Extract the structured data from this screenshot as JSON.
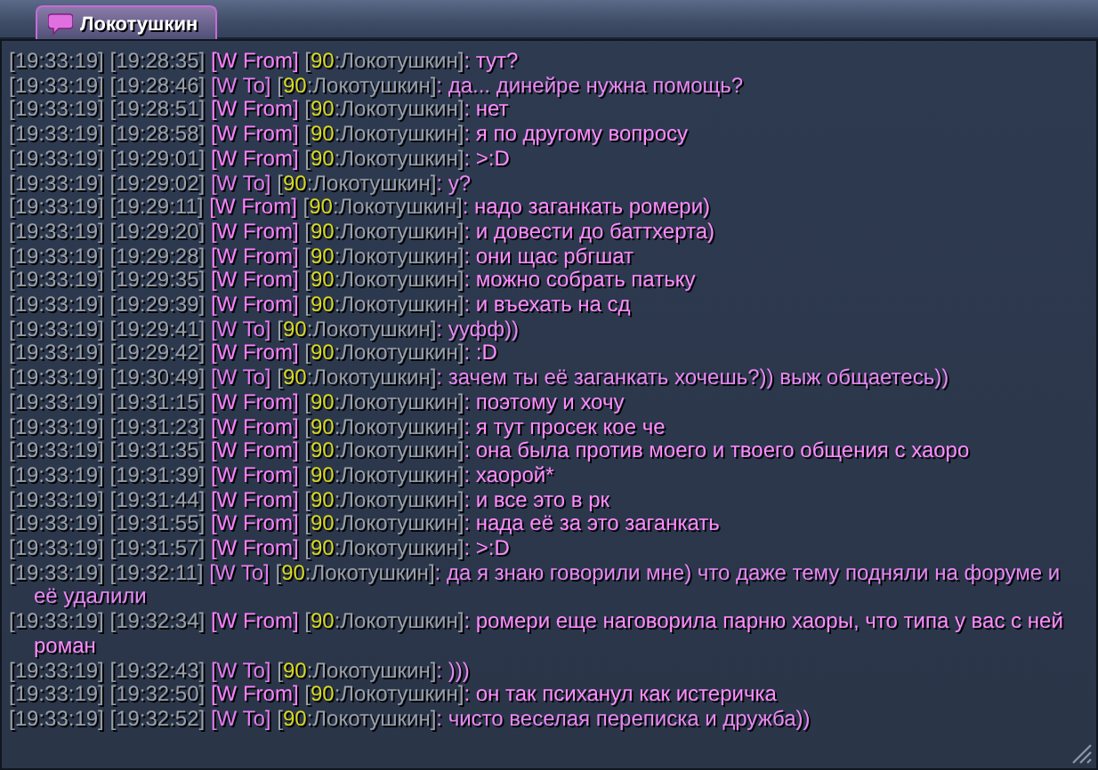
{
  "tab": {
    "label": "Локотушкин",
    "selected": true
  },
  "messages": [
    {
      "kind": "from",
      "local_time": "[19:33:19]",
      "time": "[19:28:35]",
      "channel": "[W From]",
      "sender_open": "[",
      "rank": "90",
      "sender": ":Локотушкин]",
      "text": ": тут?"
    },
    {
      "kind": "to",
      "local_time": "[19:33:19]",
      "time": "[19:28:46]",
      "channel": "[W To]",
      "sender_open": "[",
      "rank": "90",
      "sender": ":Локотушкин]",
      "text": ": да... динейре нужна помощь?"
    },
    {
      "kind": "from",
      "local_time": "[19:33:19]",
      "time": "[19:28:51]",
      "channel": "[W From]",
      "sender_open": "[",
      "rank": "90",
      "sender": ":Локотушкин]",
      "text": ": нет"
    },
    {
      "kind": "from",
      "local_time": "[19:33:19]",
      "time": "[19:28:58]",
      "channel": "[W From]",
      "sender_open": "[",
      "rank": "90",
      "sender": ":Локотушкин]",
      "text": ": я по другому вопросу"
    },
    {
      "kind": "from",
      "local_time": "[19:33:19]",
      "time": "[19:29:01]",
      "channel": "[W From]",
      "sender_open": "[",
      "rank": "90",
      "sender": ":Локотушкин]",
      "text": ": >:D"
    },
    {
      "kind": "to",
      "local_time": "[19:33:19]",
      "time": "[19:29:02]",
      "channel": "[W To]",
      "sender_open": "[",
      "rank": "90",
      "sender": ":Локотушкин]",
      "text": ": у?"
    },
    {
      "kind": "from",
      "local_time": "[19:33:19]",
      "time": "[19:29:11]",
      "channel": "[W From]",
      "sender_open": "[",
      "rank": "90",
      "sender": ":Локотушкин]",
      "text": ": надо заганкать ромери)"
    },
    {
      "kind": "from",
      "local_time": "[19:33:19]",
      "time": "[19:29:20]",
      "channel": "[W From]",
      "sender_open": "[",
      "rank": "90",
      "sender": ":Локотушкин]",
      "text": ": и довести до баттхерта)"
    },
    {
      "kind": "from",
      "local_time": "[19:33:19]",
      "time": "[19:29:28]",
      "channel": "[W From]",
      "sender_open": "[",
      "rank": "90",
      "sender": ":Локотушкин]",
      "text": ": они щас рбгшат"
    },
    {
      "kind": "from",
      "local_time": "[19:33:19]",
      "time": "[19:29:35]",
      "channel": "[W From]",
      "sender_open": "[",
      "rank": "90",
      "sender": ":Локотушкин]",
      "text": ": можно собрать патьку"
    },
    {
      "kind": "from",
      "local_time": "[19:33:19]",
      "time": "[19:29:39]",
      "channel": "[W From]",
      "sender_open": "[",
      "rank": "90",
      "sender": ":Локотушкин]",
      "text": ": и въехать на сд"
    },
    {
      "kind": "to",
      "local_time": "[19:33:19]",
      "time": "[19:29:41]",
      "channel": "[W To]",
      "sender_open": "[",
      "rank": "90",
      "sender": ":Локотушкин]",
      "text": ": ууфф))"
    },
    {
      "kind": "from",
      "local_time": "[19:33:19]",
      "time": "[19:29:42]",
      "channel": "[W From]",
      "sender_open": "[",
      "rank": "90",
      "sender": ":Локотушкин]",
      "text": ": :D"
    },
    {
      "kind": "to",
      "local_time": "[19:33:19]",
      "time": "[19:30:49]",
      "channel": "[W To]",
      "sender_open": "[",
      "rank": "90",
      "sender": ":Локотушкин]",
      "text": ": зачем ты её заганкать хочешь?)) выж общаетесь))"
    },
    {
      "kind": "from",
      "local_time": "[19:33:19]",
      "time": "[19:31:15]",
      "channel": "[W From]",
      "sender_open": "[",
      "rank": "90",
      "sender": ":Локотушкин]",
      "text": ": поэтому и хочу"
    },
    {
      "kind": "from",
      "local_time": "[19:33:19]",
      "time": "[19:31:23]",
      "channel": "[W From]",
      "sender_open": "[",
      "rank": "90",
      "sender": ":Локотушкин]",
      "text": ": я тут просек кое че"
    },
    {
      "kind": "from",
      "local_time": "[19:33:19]",
      "time": "[19:31:35]",
      "channel": "[W From]",
      "sender_open": "[",
      "rank": "90",
      "sender": ":Локотушкин]",
      "text": ": она была против моего и твоего общения с хаоро"
    },
    {
      "kind": "from",
      "local_time": "[19:33:19]",
      "time": "[19:31:39]",
      "channel": "[W From]",
      "sender_open": "[",
      "rank": "90",
      "sender": ":Локотушкин]",
      "text": ": хаорой*"
    },
    {
      "kind": "from",
      "local_time": "[19:33:19]",
      "time": "[19:31:44]",
      "channel": "[W From]",
      "sender_open": "[",
      "rank": "90",
      "sender": ":Локотушкин]",
      "text": ": и все это в рк"
    },
    {
      "kind": "from",
      "local_time": "[19:33:19]",
      "time": "[19:31:55]",
      "channel": "[W From]",
      "sender_open": "[",
      "rank": "90",
      "sender": ":Локотушкин]",
      "text": ": нада её за это заганкать"
    },
    {
      "kind": "from",
      "local_time": "[19:33:19]",
      "time": "[19:31:57]",
      "channel": "[W From]",
      "sender_open": "[",
      "rank": "90",
      "sender": ":Локотушкин]",
      "text": ": >:D"
    },
    {
      "kind": "to",
      "local_time": "[19:33:19]",
      "time": "[19:32:11]",
      "channel": "[W To]",
      "sender_open": "[",
      "rank": "90",
      "sender": ":Локотушкин]",
      "text": ": да я знаю говорили мне) что даже тему подняли на форуме и её удалили"
    },
    {
      "kind": "from",
      "local_time": "[19:33:19]",
      "time": "[19:32:34]",
      "channel": "[W From]",
      "sender_open": "[",
      "rank": "90",
      "sender": ":Локотушкин]",
      "text": ": ромери еще наговорила парню хаоры, что типа у вас с ней роман"
    },
    {
      "kind": "to",
      "local_time": "[19:33:19]",
      "time": "[19:32:43]",
      "channel": "[W To]",
      "sender_open": "[",
      "rank": "90",
      "sender": ":Локотушкин]",
      "text": ": )))"
    },
    {
      "kind": "from",
      "local_time": "[19:33:19]",
      "time": "[19:32:50]",
      "channel": "[W From]",
      "sender_open": "[",
      "rank": "90",
      "sender": ":Локотушкин]",
      "text": ": он так психанул как истеричка"
    },
    {
      "kind": "to",
      "local_time": "[19:33:19]",
      "time": "[19:32:52]",
      "channel": "[W To]",
      "sender_open": "[",
      "rank": "90",
      "sender": ":Локотушкин]",
      "text": ": чисто веселая переписка и дружба))"
    }
  ]
}
